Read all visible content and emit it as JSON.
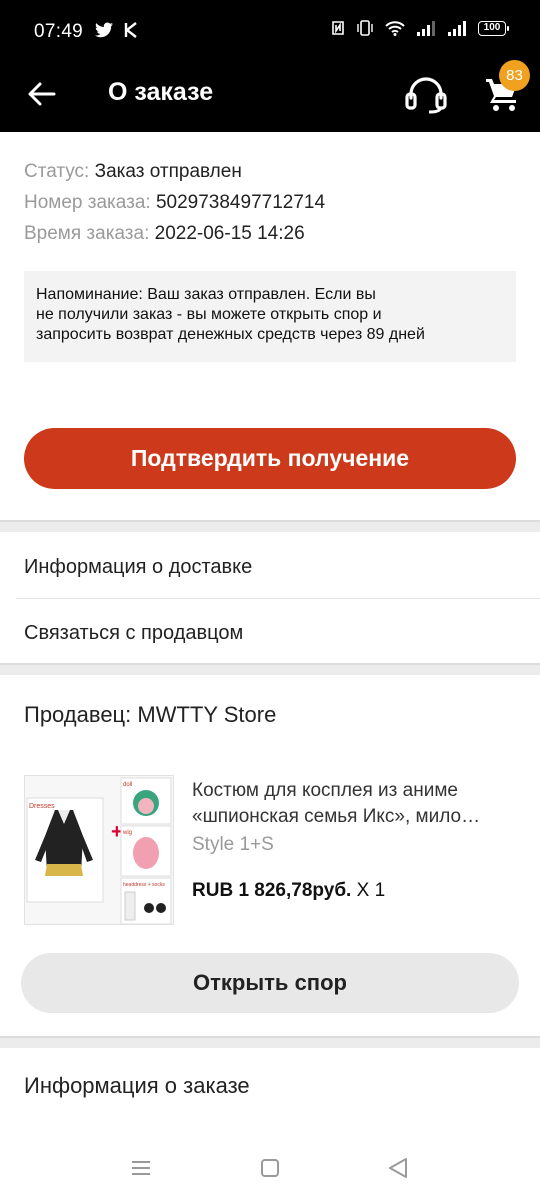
{
  "status_bar": {
    "time": "07:49",
    "battery": "100",
    "icons": [
      "twitter-icon",
      "k-app-icon",
      "nfc-icon",
      "vibrate-icon",
      "wifi-icon",
      "signal-icon",
      "signal-icon"
    ]
  },
  "appbar": {
    "title": "О заказе",
    "cart_badge": "83"
  },
  "order": {
    "status_label": "Статус:",
    "status_value": "Заказ отправлен",
    "number_label": "Номер заказа:",
    "number_value": "5029738497712714",
    "time_label": "Время заказа:",
    "time_value": "2022-06-15 14:26"
  },
  "reminder": {
    "line1": "Напоминание: Ваш заказ отправлен. Если вы",
    "line2": "не получили заказ - вы можете открыть спор и",
    "line3": "запросить возврат денежных средств через 89 дней"
  },
  "actions": {
    "confirm_label": "Подтвердить получение",
    "dispute_label": "Открыть спор"
  },
  "menu": {
    "delivery_info": "Информация о доставке",
    "contact_seller": "Связаться с продавцом",
    "order_info": "Информация о заказе"
  },
  "seller": {
    "label": "Продавец: MWTTY Store"
  },
  "product": {
    "title_line1": "Костюм для косплея из аниме",
    "title_line2": "«шпионская семья Икс», мило…",
    "style": "Style 1+S",
    "price": "RUB 1 826,78руб.",
    "quantity": "X 1",
    "image_labels": {
      "dresses": "Dresses",
      "doll": "doll",
      "wig": "wig",
      "headdress": "headdress + socks"
    }
  },
  "colors": {
    "accent": "#cc3a1b",
    "badge": "#f0a11f",
    "header_bg": "#000000"
  }
}
